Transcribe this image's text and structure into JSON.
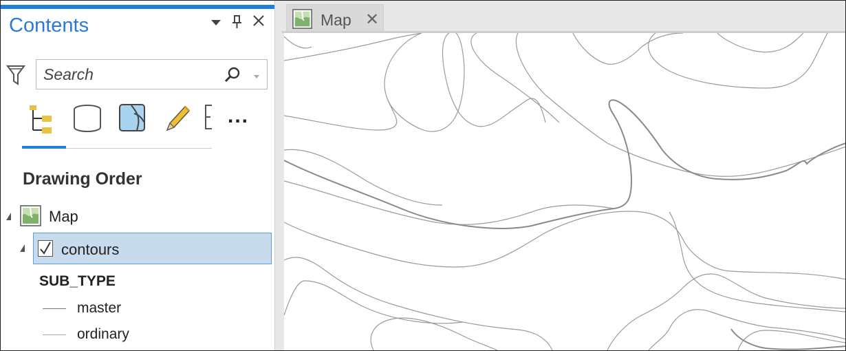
{
  "contents_pane": {
    "title": "Contents",
    "search": {
      "placeholder": "Search",
      "value": ""
    },
    "view_tabs": [
      {
        "icon": "drawing-order-icon",
        "selected": true
      },
      {
        "icon": "data-source-icon",
        "selected": false
      },
      {
        "icon": "selection-icon",
        "selected": false
      },
      {
        "icon": "editing-icon",
        "selected": false
      },
      {
        "icon": "snapping-icon",
        "selected": false
      }
    ],
    "more_label": "...",
    "section_title": "Drawing Order",
    "tree": {
      "map": {
        "label": "Map"
      },
      "layer": {
        "label": "contours",
        "checked": true,
        "field_name": "SUB_TYPE",
        "legend": [
          {
            "label": "master"
          },
          {
            "label": "ordinary"
          }
        ]
      }
    }
  },
  "map_view": {
    "tab_label": "Map",
    "tab_close": "✕"
  },
  "colors": {
    "accent": "#1e7fd6",
    "selected_row": "#c8dbec",
    "contour_master": "#8a8a8a",
    "contour_ordinary": "#9a9a9a"
  }
}
